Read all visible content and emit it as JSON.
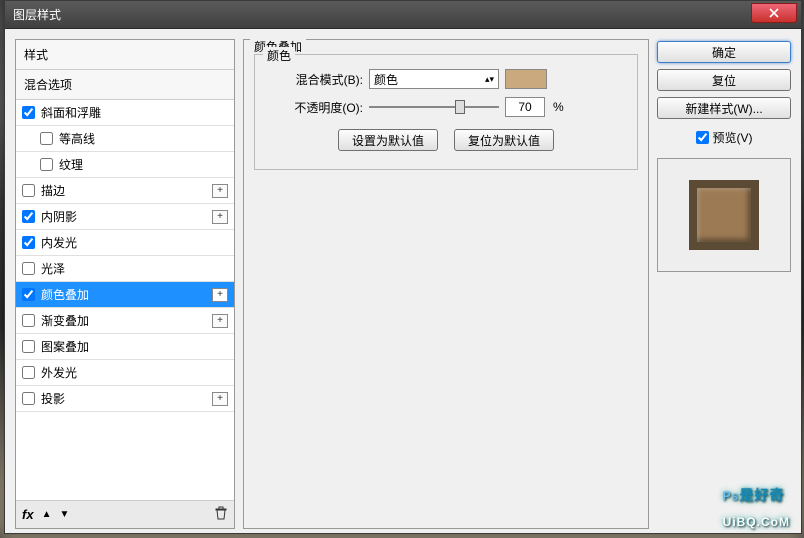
{
  "window": {
    "title": "图层样式"
  },
  "sidebar": {
    "styles_header": "样式",
    "blend_header": "混合选项",
    "items": [
      {
        "label": "斜面和浮雕",
        "checked": true,
        "plus": false,
        "indent": false
      },
      {
        "label": "等高线",
        "checked": false,
        "plus": false,
        "indent": true
      },
      {
        "label": "纹理",
        "checked": false,
        "plus": false,
        "indent": true
      },
      {
        "label": "描边",
        "checked": false,
        "plus": true,
        "indent": false
      },
      {
        "label": "内阴影",
        "checked": true,
        "plus": true,
        "indent": false
      },
      {
        "label": "内发光",
        "checked": true,
        "plus": false,
        "indent": false
      },
      {
        "label": "光泽",
        "checked": false,
        "plus": false,
        "indent": false
      },
      {
        "label": "颜色叠加",
        "checked": true,
        "plus": true,
        "indent": false,
        "selected": true
      },
      {
        "label": "渐变叠加",
        "checked": false,
        "plus": true,
        "indent": false
      },
      {
        "label": "图案叠加",
        "checked": false,
        "plus": false,
        "indent": false
      },
      {
        "label": "外发光",
        "checked": false,
        "plus": false,
        "indent": false
      },
      {
        "label": "投影",
        "checked": false,
        "plus": true,
        "indent": false
      }
    ],
    "footer_fx": "fx"
  },
  "panel": {
    "title": "颜色叠加",
    "group": "颜色",
    "blend_mode_label": "混合模式(B):",
    "blend_mode_value": "颜色",
    "swatch_color": "#caa97f",
    "opacity_label": "不透明度(O):",
    "opacity_value": "70",
    "opacity_unit": "%",
    "set_default": "设置为默认值",
    "reset_default": "复位为默认值"
  },
  "buttons": {
    "ok": "确定",
    "cancel": "复位",
    "new_style": "新建样式(W)...",
    "preview": "预览(V)"
  },
  "watermark": {
    "ps": "Ps",
    "cn": "是好奇",
    "domain": "UiBQ.CoM"
  }
}
